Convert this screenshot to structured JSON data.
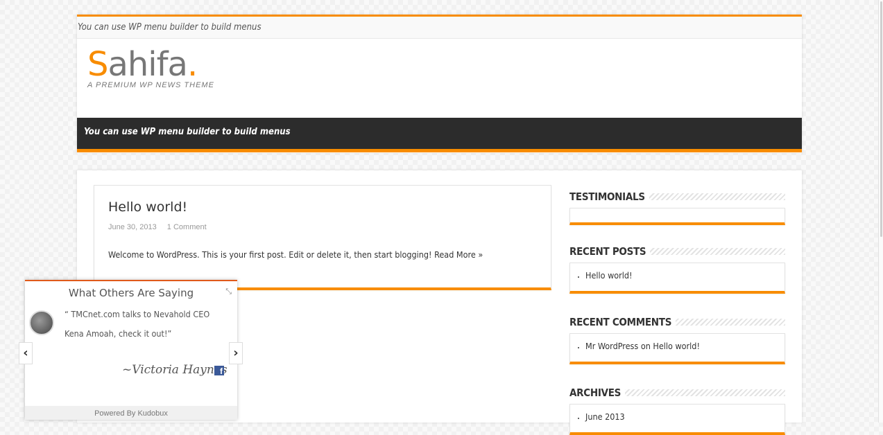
{
  "header": {
    "top_menu_notice": "You can use WP menu builder to build menus",
    "logo": {
      "first_letter": "S",
      "rest": "ahifa",
      "dot": "."
    },
    "tagline": "A PREMIUM WP NEWS THEME",
    "main_menu_notice": "You can use WP menu builder to build menus"
  },
  "post": {
    "title": "Hello world!",
    "date": "June 30, 2013",
    "comments": "1 Comment",
    "excerpt": "Welcome to WordPress. This is your first post. Edit or delete it, then start blogging! Read More »"
  },
  "sidebar": {
    "testimonials": {
      "title": "Testimonials"
    },
    "recent_posts": {
      "title": "Recent Posts",
      "items": [
        "Hello world!"
      ]
    },
    "recent_comments": {
      "title": "Recent Comments",
      "items": [
        "Mr WordPress on Hello world!"
      ]
    },
    "archives": {
      "title": "Archives",
      "items": [
        "June 2013"
      ]
    }
  },
  "testimonial_widget": {
    "title": "What Others Are Saying",
    "quote_line1": "“ TMCnet.com talks to Nevahold CEO",
    "quote_line2": "Kena Amoah, check it out!”",
    "author": "~Victoria Haynes",
    "facebook_glyph": "f",
    "prev_glyph": "‹",
    "next_glyph": "›",
    "collapse_glyph": "⤡",
    "powered_by": "Powered By Kudobux"
  },
  "colors": {
    "accent": "#f88c00",
    "nav_bg": "#2c2c2c"
  }
}
